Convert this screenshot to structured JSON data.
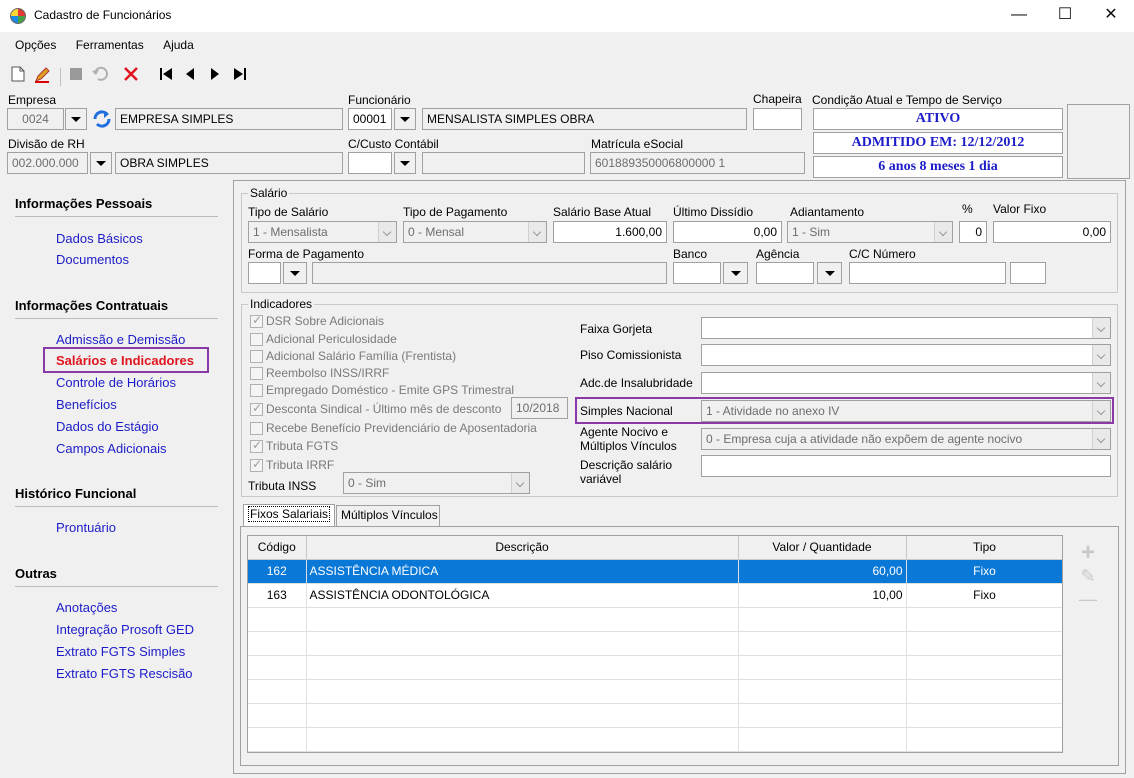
{
  "window": {
    "title": "Cadastro de Funcionários",
    "minimize": "—",
    "maximize": "☐",
    "close": "✕"
  },
  "menu": [
    "Opções",
    "Ferramentas",
    "Ajuda"
  ],
  "header": {
    "empresa_label": "Empresa",
    "empresa_code": "0024",
    "empresa_name": "EMPRESA SIMPLES",
    "funcionario_label": "Funcionário",
    "funcionario_code": "00001",
    "funcionario_name": "MENSALISTA SIMPLES OBRA",
    "chapeira_label": "Chapeira",
    "chapeira_value": "",
    "divisao_label": "Divisão de RH",
    "divisao_code": "002.000.000",
    "divisao_name": "OBRA SIMPLES",
    "ccusto_label": "C/Custo Contábil",
    "ccusto_value": "",
    "matricula_label": "Matrícula eSocial",
    "matricula_value": "601889350006800000 1",
    "condicao_label": "Condição Atual e Tempo de Serviço",
    "status": "ATIVO",
    "admitido": "ADMITIDO EM: 12/12/2012",
    "tempo": "6 anos 8 meses 1 dia"
  },
  "sidebar": {
    "sections": [
      {
        "title": "Informações Pessoais",
        "items": [
          "Dados Básicos",
          "Documentos"
        ]
      },
      {
        "title": "Informações Contratuais",
        "items": [
          "Admissão e Demissão",
          "Salários e Indicadores",
          "Controle de Horários",
          "Benefícios",
          "Dados do Estágio",
          "Campos Adicionais"
        ]
      },
      {
        "title": "Histórico Funcional",
        "items": [
          "Prontuário"
        ]
      },
      {
        "title": "Outras",
        "items": [
          "Anotações",
          "Integração Prosoft GED",
          "Extrato FGTS Simples",
          "Extrato FGTS Rescisão"
        ]
      }
    ],
    "active_item": "Salários e Indicadores"
  },
  "salario": {
    "group_title": "Salário",
    "tipo_salario_label": "Tipo de Salário",
    "tipo_salario": "1 - Mensalista",
    "tipo_pagamento_label": "Tipo de Pagamento",
    "tipo_pagamento": "0 - Mensal",
    "base_label": "Salário Base Atual",
    "base": "1.600,00",
    "dissidio_label": "Último Dissídio",
    "dissidio": "0,00",
    "adiantamento_label": "Adiantamento",
    "adiantamento": "1 - Sim",
    "pct_label": "%",
    "pct": "0",
    "valor_fixo_label": "Valor Fixo",
    "valor_fixo": "0,00",
    "forma_label": "Forma de Pagamento",
    "banco_label": "Banco",
    "agencia_label": "Agência",
    "cc_label": "C/C Número"
  },
  "indicadores": {
    "group_title": "Indicadores",
    "checks": [
      {
        "label": "DSR Sobre Adicionais",
        "checked": true
      },
      {
        "label": "Adicional Periculosidade",
        "checked": false
      },
      {
        "label": "Adicional Salário Família (Frentista)",
        "checked": false
      },
      {
        "label": "Reembolso INSS/IRRF",
        "checked": false
      },
      {
        "label": "Empregado Doméstico - Emite GPS Trimestral",
        "checked": false
      },
      {
        "label": "Desconta Sindical - Último mês de desconto",
        "checked": true
      },
      {
        "label": "Recebe Benefício Previdenciário de Aposentadoria",
        "checked": false
      },
      {
        "label": "Tributa FGTS",
        "checked": true
      },
      {
        "label": "Tributa IRRF",
        "checked": true
      }
    ],
    "sindical_mes": "10/2018",
    "tributa_inss_label": "Tributa INSS",
    "tributa_inss": "0 - Sim",
    "faixa_gorjeta_label": "Faixa Gorjeta",
    "piso_label": "Piso Comissionista",
    "insalubridade_label": "Adc.de Insalubridade",
    "simples_label": "Simples Nacional",
    "simples_value": "1 - Atividade no anexo IV",
    "agente_label": "Agente Nocivo e Múltiplos Vínculos",
    "agente_value": "0 - Empresa cuja a atividade não expõem de agente nocivo",
    "descricao_label": "Descrição salário variável"
  },
  "tabs": [
    "Fixos Salariais",
    "Múltiplos Vínculos"
  ],
  "table": {
    "columns": [
      "Código",
      "Descrição",
      "Valor / Quantidade",
      "Tipo"
    ],
    "rows": [
      {
        "codigo": "162",
        "descricao": "ASSISTÊNCIA MÉDICA",
        "valor": "60,00",
        "tipo": "Fixo",
        "selected": true
      },
      {
        "codigo": "163",
        "descricao": "ASSISTÊNCIA ODONTOLÓGICA",
        "valor": "10,00",
        "tipo": "Fixo",
        "selected": false
      }
    ],
    "actions": {
      "add": "+",
      "edit": "✎",
      "remove": "—"
    }
  },
  "colors": {
    "link": "#1c1cc8",
    "active_link": "#e0141e",
    "highlight": "#8a3aa6",
    "selection": "#0a78d7"
  }
}
